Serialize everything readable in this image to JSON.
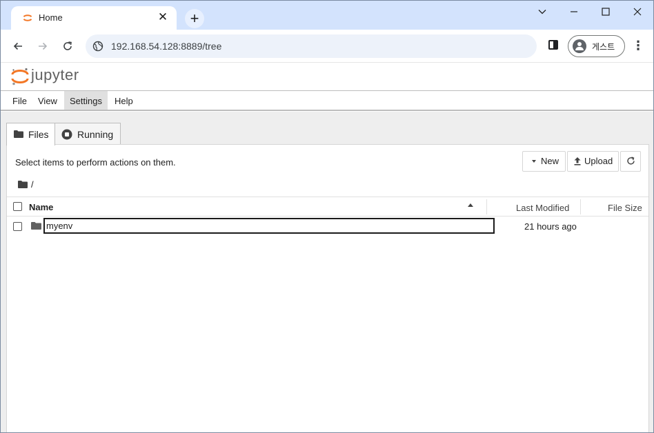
{
  "browser": {
    "tab_title": "Home",
    "tab_close_glyph": "✕",
    "new_tab_glyph": "+",
    "url": "192.168.54.128:8889/tree",
    "profile_label": "게스트",
    "window_controls": {
      "minimize": "chevron-down-icon",
      "restore": "minimize-icon",
      "maximize": "maximize-icon",
      "close": "close-icon"
    }
  },
  "jupyter": {
    "wordmark": "jupyter",
    "accent_color": "#f37726"
  },
  "menu": {
    "items": [
      "File",
      "View",
      "Settings",
      "Help"
    ],
    "active": "Settings"
  },
  "filebrowser": {
    "tabs": [
      {
        "label": "Files",
        "icon": "folder-icon",
        "active": true
      },
      {
        "label": "Running",
        "icon": "stop-circle-icon",
        "active": false
      }
    ],
    "instruction": "Select items to perform actions on them.",
    "buttons": {
      "new_label": "New",
      "upload_label": "Upload",
      "refresh_icon": "refresh-icon"
    },
    "breadcrumb": "/",
    "columns": {
      "name": "Name",
      "last_modified": "Last Modified",
      "file_size": "File Size"
    },
    "sort": {
      "column": "Name",
      "direction": "ascending"
    },
    "rows": [
      {
        "name": "myenv",
        "type": "directory",
        "last_modified": "21 hours ago",
        "file_size": ""
      }
    ]
  }
}
